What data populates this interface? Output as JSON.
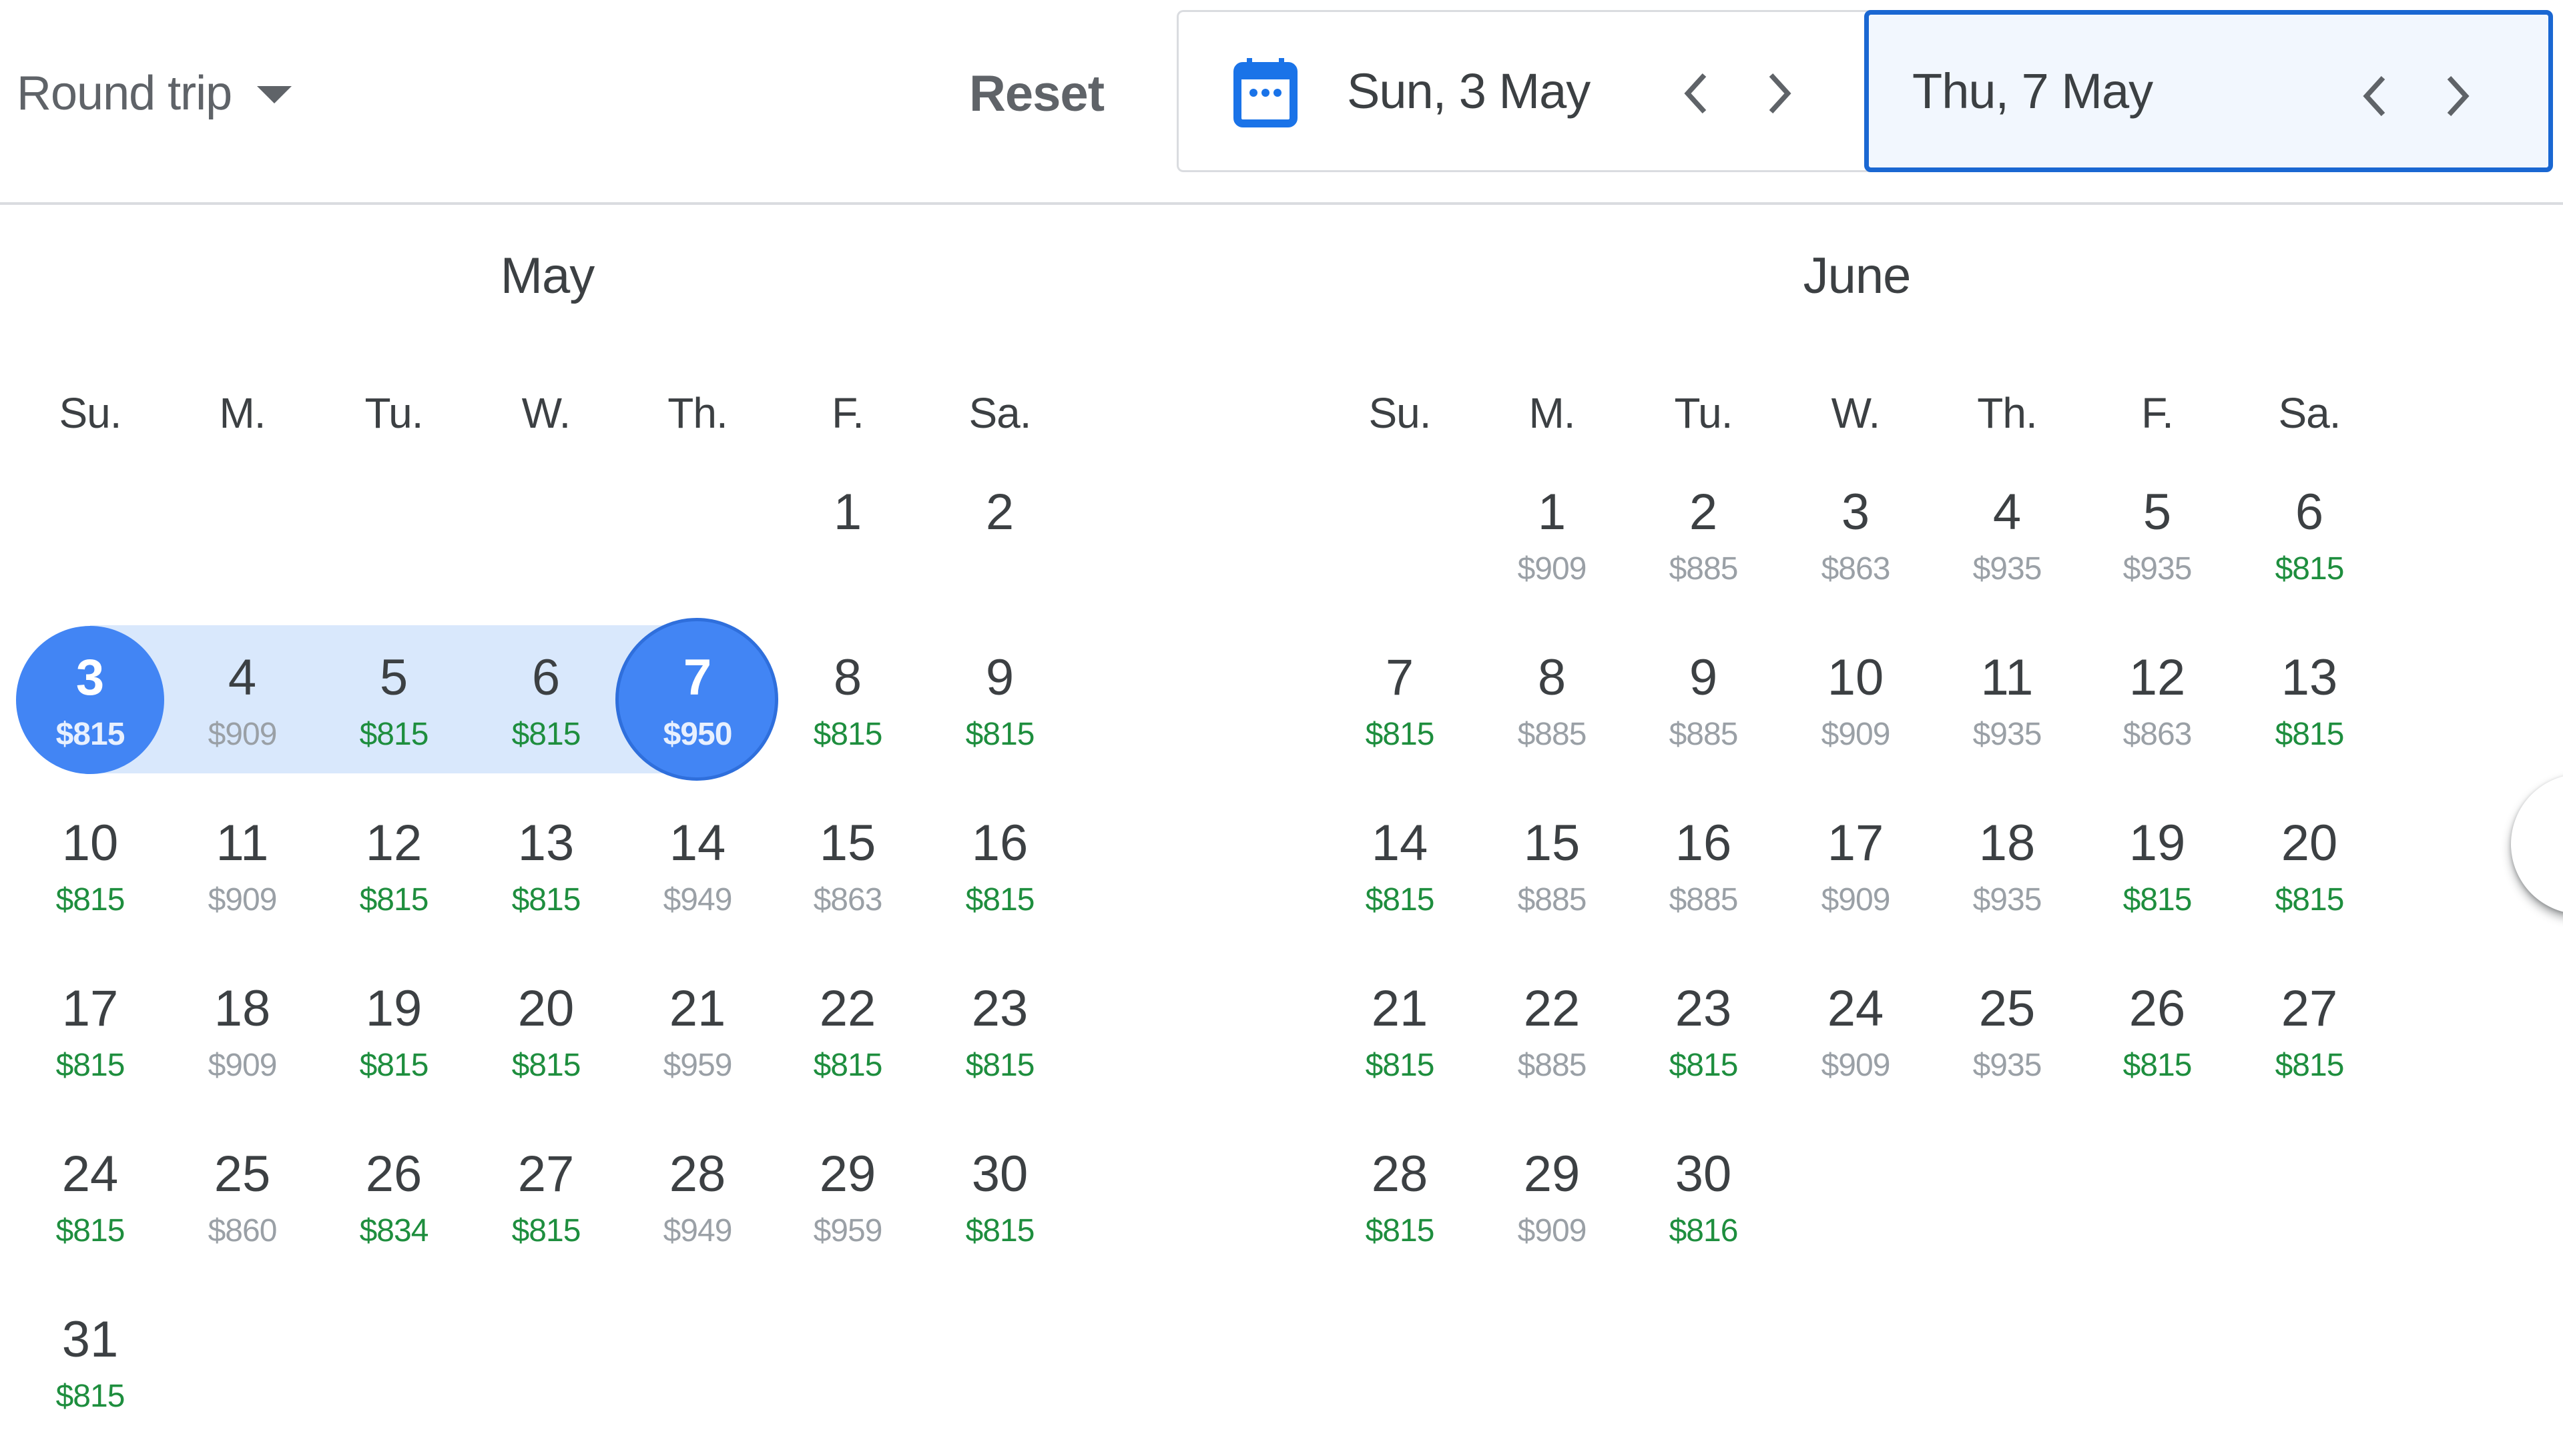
{
  "top_bar": {
    "trip_type": "Round trip",
    "reset_label": "Reset",
    "departure_date": "Sun, 3 May",
    "return_date": "Thu, 7 May",
    "accent_color": "#1a73e8"
  },
  "weekdays": [
    "Su.",
    "M.",
    "Tu.",
    "W.",
    "Th.",
    "F.",
    "Sa."
  ],
  "price_colors": {
    "low": "#1e8e3e",
    "high": "#9aa0a6"
  },
  "selection": {
    "start": {
      "month": "May",
      "day": 3
    },
    "end": {
      "month": "May",
      "day": 7
    }
  },
  "months": [
    {
      "title": "May",
      "first_weekday_index": 5,
      "days": [
        {
          "day": 1,
          "price": null,
          "tier": null
        },
        {
          "day": 2,
          "price": null,
          "tier": null
        },
        {
          "day": 3,
          "price": "$815",
          "tier": "low"
        },
        {
          "day": 4,
          "price": "$909",
          "tier": "high"
        },
        {
          "day": 5,
          "price": "$815",
          "tier": "low"
        },
        {
          "day": 6,
          "price": "$815",
          "tier": "low"
        },
        {
          "day": 7,
          "price": "$950",
          "tier": "high"
        },
        {
          "day": 8,
          "price": "$815",
          "tier": "low"
        },
        {
          "day": 9,
          "price": "$815",
          "tier": "low"
        },
        {
          "day": 10,
          "price": "$815",
          "tier": "low"
        },
        {
          "day": 11,
          "price": "$909",
          "tier": "high"
        },
        {
          "day": 12,
          "price": "$815",
          "tier": "low"
        },
        {
          "day": 13,
          "price": "$815",
          "tier": "low"
        },
        {
          "day": 14,
          "price": "$949",
          "tier": "high"
        },
        {
          "day": 15,
          "price": "$863",
          "tier": "high"
        },
        {
          "day": 16,
          "price": "$815",
          "tier": "low"
        },
        {
          "day": 17,
          "price": "$815",
          "tier": "low"
        },
        {
          "day": 18,
          "price": "$909",
          "tier": "high"
        },
        {
          "day": 19,
          "price": "$815",
          "tier": "low"
        },
        {
          "day": 20,
          "price": "$815",
          "tier": "low"
        },
        {
          "day": 21,
          "price": "$959",
          "tier": "high"
        },
        {
          "day": 22,
          "price": "$815",
          "tier": "low"
        },
        {
          "day": 23,
          "price": "$815",
          "tier": "low"
        },
        {
          "day": 24,
          "price": "$815",
          "tier": "low"
        },
        {
          "day": 25,
          "price": "$860",
          "tier": "high"
        },
        {
          "day": 26,
          "price": "$834",
          "tier": "low"
        },
        {
          "day": 27,
          "price": "$815",
          "tier": "low"
        },
        {
          "day": 28,
          "price": "$949",
          "tier": "high"
        },
        {
          "day": 29,
          "price": "$959",
          "tier": "high"
        },
        {
          "day": 30,
          "price": "$815",
          "tier": "low"
        },
        {
          "day": 31,
          "price": "$815",
          "tier": "low"
        }
      ]
    },
    {
      "title": "June",
      "first_weekday_index": 1,
      "days": [
        {
          "day": 1,
          "price": "$909",
          "tier": "high"
        },
        {
          "day": 2,
          "price": "$885",
          "tier": "high"
        },
        {
          "day": 3,
          "price": "$863",
          "tier": "high"
        },
        {
          "day": 4,
          "price": "$935",
          "tier": "high"
        },
        {
          "day": 5,
          "price": "$935",
          "tier": "high"
        },
        {
          "day": 6,
          "price": "$815",
          "tier": "low"
        },
        {
          "day": 7,
          "price": "$815",
          "tier": "low"
        },
        {
          "day": 8,
          "price": "$885",
          "tier": "high"
        },
        {
          "day": 9,
          "price": "$885",
          "tier": "high"
        },
        {
          "day": 10,
          "price": "$909",
          "tier": "high"
        },
        {
          "day": 11,
          "price": "$935",
          "tier": "high"
        },
        {
          "day": 12,
          "price": "$863",
          "tier": "high"
        },
        {
          "day": 13,
          "price": "$815",
          "tier": "low"
        },
        {
          "day": 14,
          "price": "$815",
          "tier": "low"
        },
        {
          "day": 15,
          "price": "$885",
          "tier": "high"
        },
        {
          "day": 16,
          "price": "$885",
          "tier": "high"
        },
        {
          "day": 17,
          "price": "$909",
          "tier": "high"
        },
        {
          "day": 18,
          "price": "$935",
          "tier": "high"
        },
        {
          "day": 19,
          "price": "$815",
          "tier": "low"
        },
        {
          "day": 20,
          "price": "$815",
          "tier": "low"
        },
        {
          "day": 21,
          "price": "$815",
          "tier": "low"
        },
        {
          "day": 22,
          "price": "$885",
          "tier": "high"
        },
        {
          "day": 23,
          "price": "$815",
          "tier": "low"
        },
        {
          "day": 24,
          "price": "$909",
          "tier": "high"
        },
        {
          "day": 25,
          "price": "$935",
          "tier": "high"
        },
        {
          "day": 26,
          "price": "$815",
          "tier": "low"
        },
        {
          "day": 27,
          "price": "$815",
          "tier": "low"
        },
        {
          "day": 28,
          "price": "$815",
          "tier": "low"
        },
        {
          "day": 29,
          "price": "$909",
          "tier": "high"
        },
        {
          "day": 30,
          "price": "$816",
          "tier": "low"
        }
      ]
    }
  ]
}
